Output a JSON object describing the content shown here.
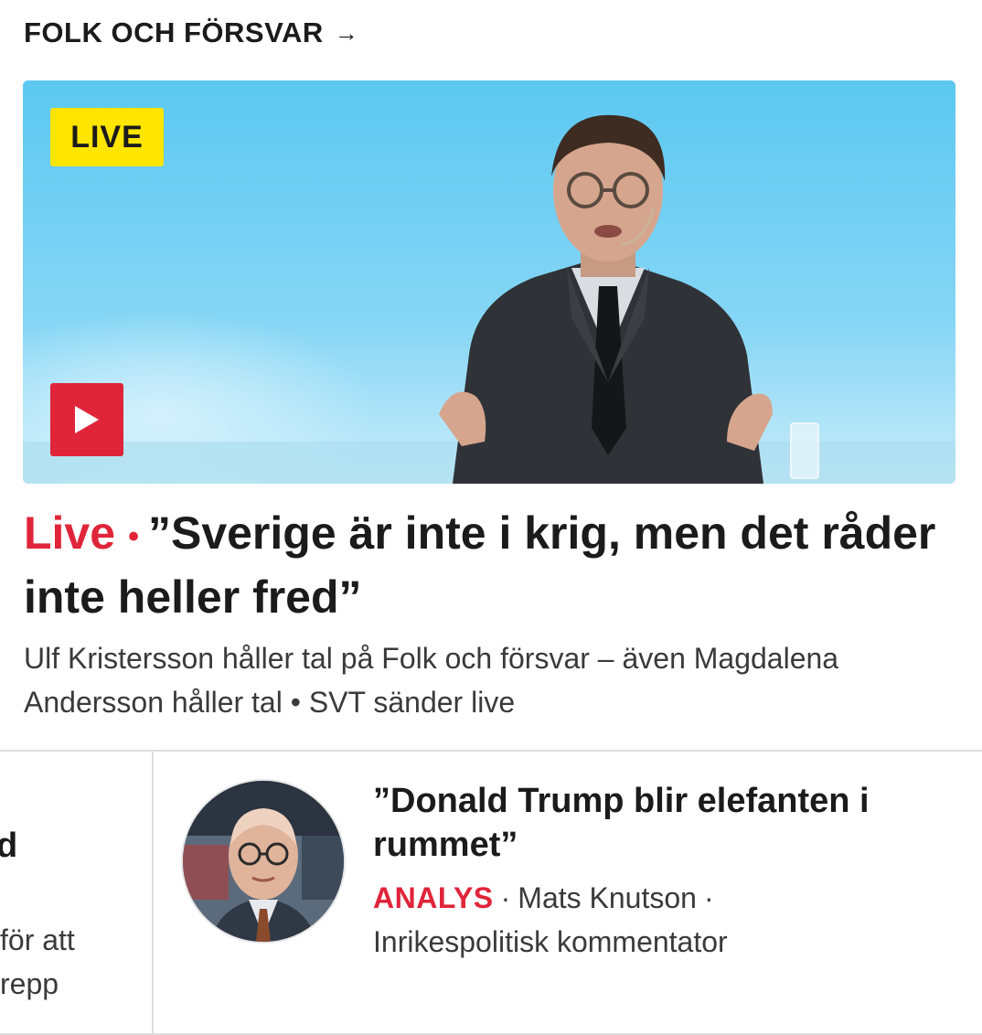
{
  "section": {
    "title": "FOLK OCH FÖRSVAR",
    "arrow": "→"
  },
  "hero": {
    "badge": "LIVE",
    "play_icon": "play-icon",
    "colors": {
      "badge_bg": "#ffe500",
      "play_bg": "#e0253a"
    }
  },
  "headline": {
    "live_tag": "Live",
    "separator": "•",
    "text": "”Sverige är inte i krig, men det råder inte heller fred”"
  },
  "summary": "Ulf Kristersson håller tal på Folk och försvar – även Magdalena Andersson håller tal • SVT sänder live",
  "left_card": {
    "title_fragment": "d",
    "text_line_1": "för att",
    "text_line_2": "repp"
  },
  "right_card": {
    "title": "”Donald Trump blir elefanten i rummet”",
    "label": "ANALYS",
    "separator": "·",
    "author": "Mats Knutson",
    "role_separator": "·",
    "role": "Inrikespolitisk kommentator"
  },
  "accent_color": "#e0253a"
}
